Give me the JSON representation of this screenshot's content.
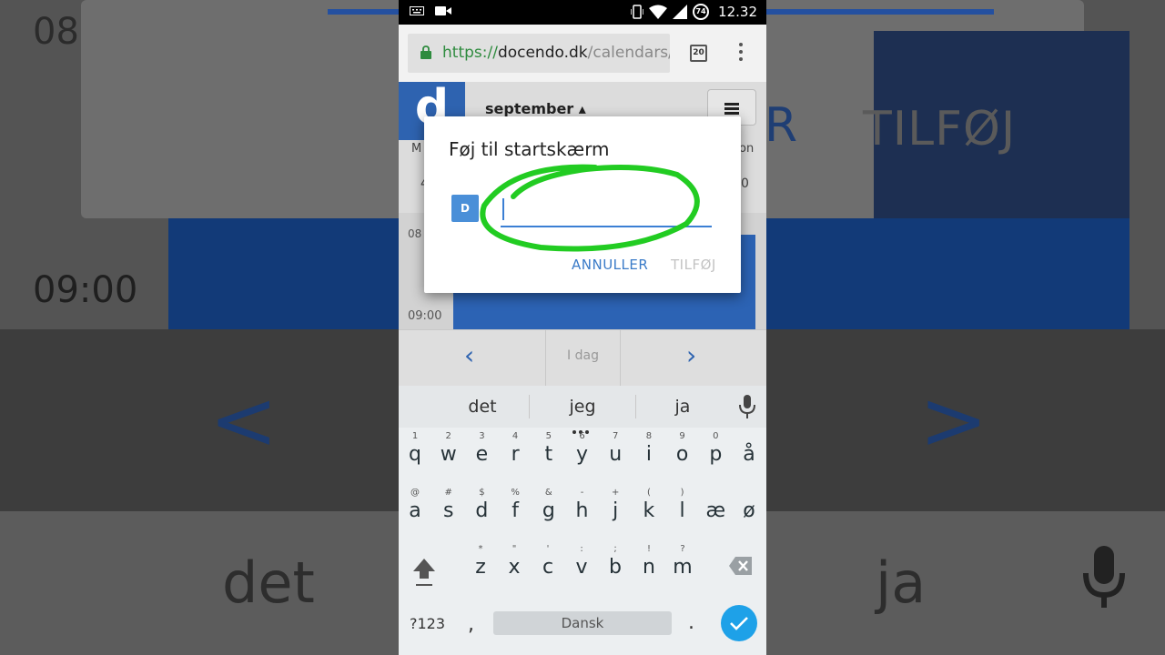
{
  "background": {
    "time_top": "08",
    "time_mid": "09:00",
    "add_label": "TILFØJ",
    "r_fragment": "R",
    "chevron_left": "<",
    "chevron_right": ">",
    "word_left": "det",
    "word_right": "ja"
  },
  "statusbar": {
    "clock": "12.32",
    "battery_level": "74",
    "icons": [
      "keyboard-icon",
      "video-icon",
      "vibrate-icon",
      "wifi-icon",
      "signal-icon",
      "battery-icon"
    ]
  },
  "browser": {
    "url_protocol": "https://",
    "url_domain": "docendo.dk",
    "url_path": "/calendars/",
    "tab_count": "20",
    "colors": {
      "lock": "#2e8b3e"
    }
  },
  "app": {
    "logo_letter": "d",
    "month_label": "september ▴",
    "day_head_left": "M",
    "day_head_right": "on",
    "day_num_left": "4",
    "day_num_right": "0",
    "time_08": "08",
    "time_09": "09:00",
    "today_label": "I dag",
    "accent": "#2e63b0"
  },
  "dialog": {
    "title": "Føj til startskærm",
    "icon_letter": "D",
    "input_value": "",
    "cancel_label": "ANNULLER",
    "add_label": "TILFØJ",
    "colors": {
      "highlight": "#22cc22",
      "primary": "#3a7bc8"
    }
  },
  "keyboard": {
    "suggestions": [
      "det",
      "jeg",
      "ja"
    ],
    "row1": [
      {
        "ch": "q",
        "hint": "1"
      },
      {
        "ch": "w",
        "hint": "2"
      },
      {
        "ch": "e",
        "hint": "3"
      },
      {
        "ch": "r",
        "hint": "4"
      },
      {
        "ch": "t",
        "hint": "5"
      },
      {
        "ch": "y",
        "hint": "6"
      },
      {
        "ch": "u",
        "hint": "7"
      },
      {
        "ch": "i",
        "hint": "8"
      },
      {
        "ch": "o",
        "hint": "9"
      },
      {
        "ch": "p",
        "hint": "0"
      },
      {
        "ch": "å",
        "hint": ""
      }
    ],
    "row2": [
      {
        "ch": "a",
        "hint": "@"
      },
      {
        "ch": "s",
        "hint": "#"
      },
      {
        "ch": "d",
        "hint": "$"
      },
      {
        "ch": "f",
        "hint": "%"
      },
      {
        "ch": "g",
        "hint": "&"
      },
      {
        "ch": "h",
        "hint": "-"
      },
      {
        "ch": "j",
        "hint": "+"
      },
      {
        "ch": "k",
        "hint": "("
      },
      {
        "ch": "l",
        "hint": ")"
      },
      {
        "ch": "æ",
        "hint": ""
      },
      {
        "ch": "ø",
        "hint": ""
      }
    ],
    "row3": [
      {
        "ch": "z",
        "hint": "*"
      },
      {
        "ch": "x",
        "hint": "\""
      },
      {
        "ch": "c",
        "hint": "'"
      },
      {
        "ch": "v",
        "hint": ":"
      },
      {
        "ch": "b",
        "hint": ";"
      },
      {
        "ch": "n",
        "hint": "!"
      },
      {
        "ch": "m",
        "hint": "?"
      }
    ],
    "symbols_label": "?123",
    "comma": ",",
    "space_label": "Dansk",
    "period": ".",
    "enter_color": "#1ea1e8"
  }
}
